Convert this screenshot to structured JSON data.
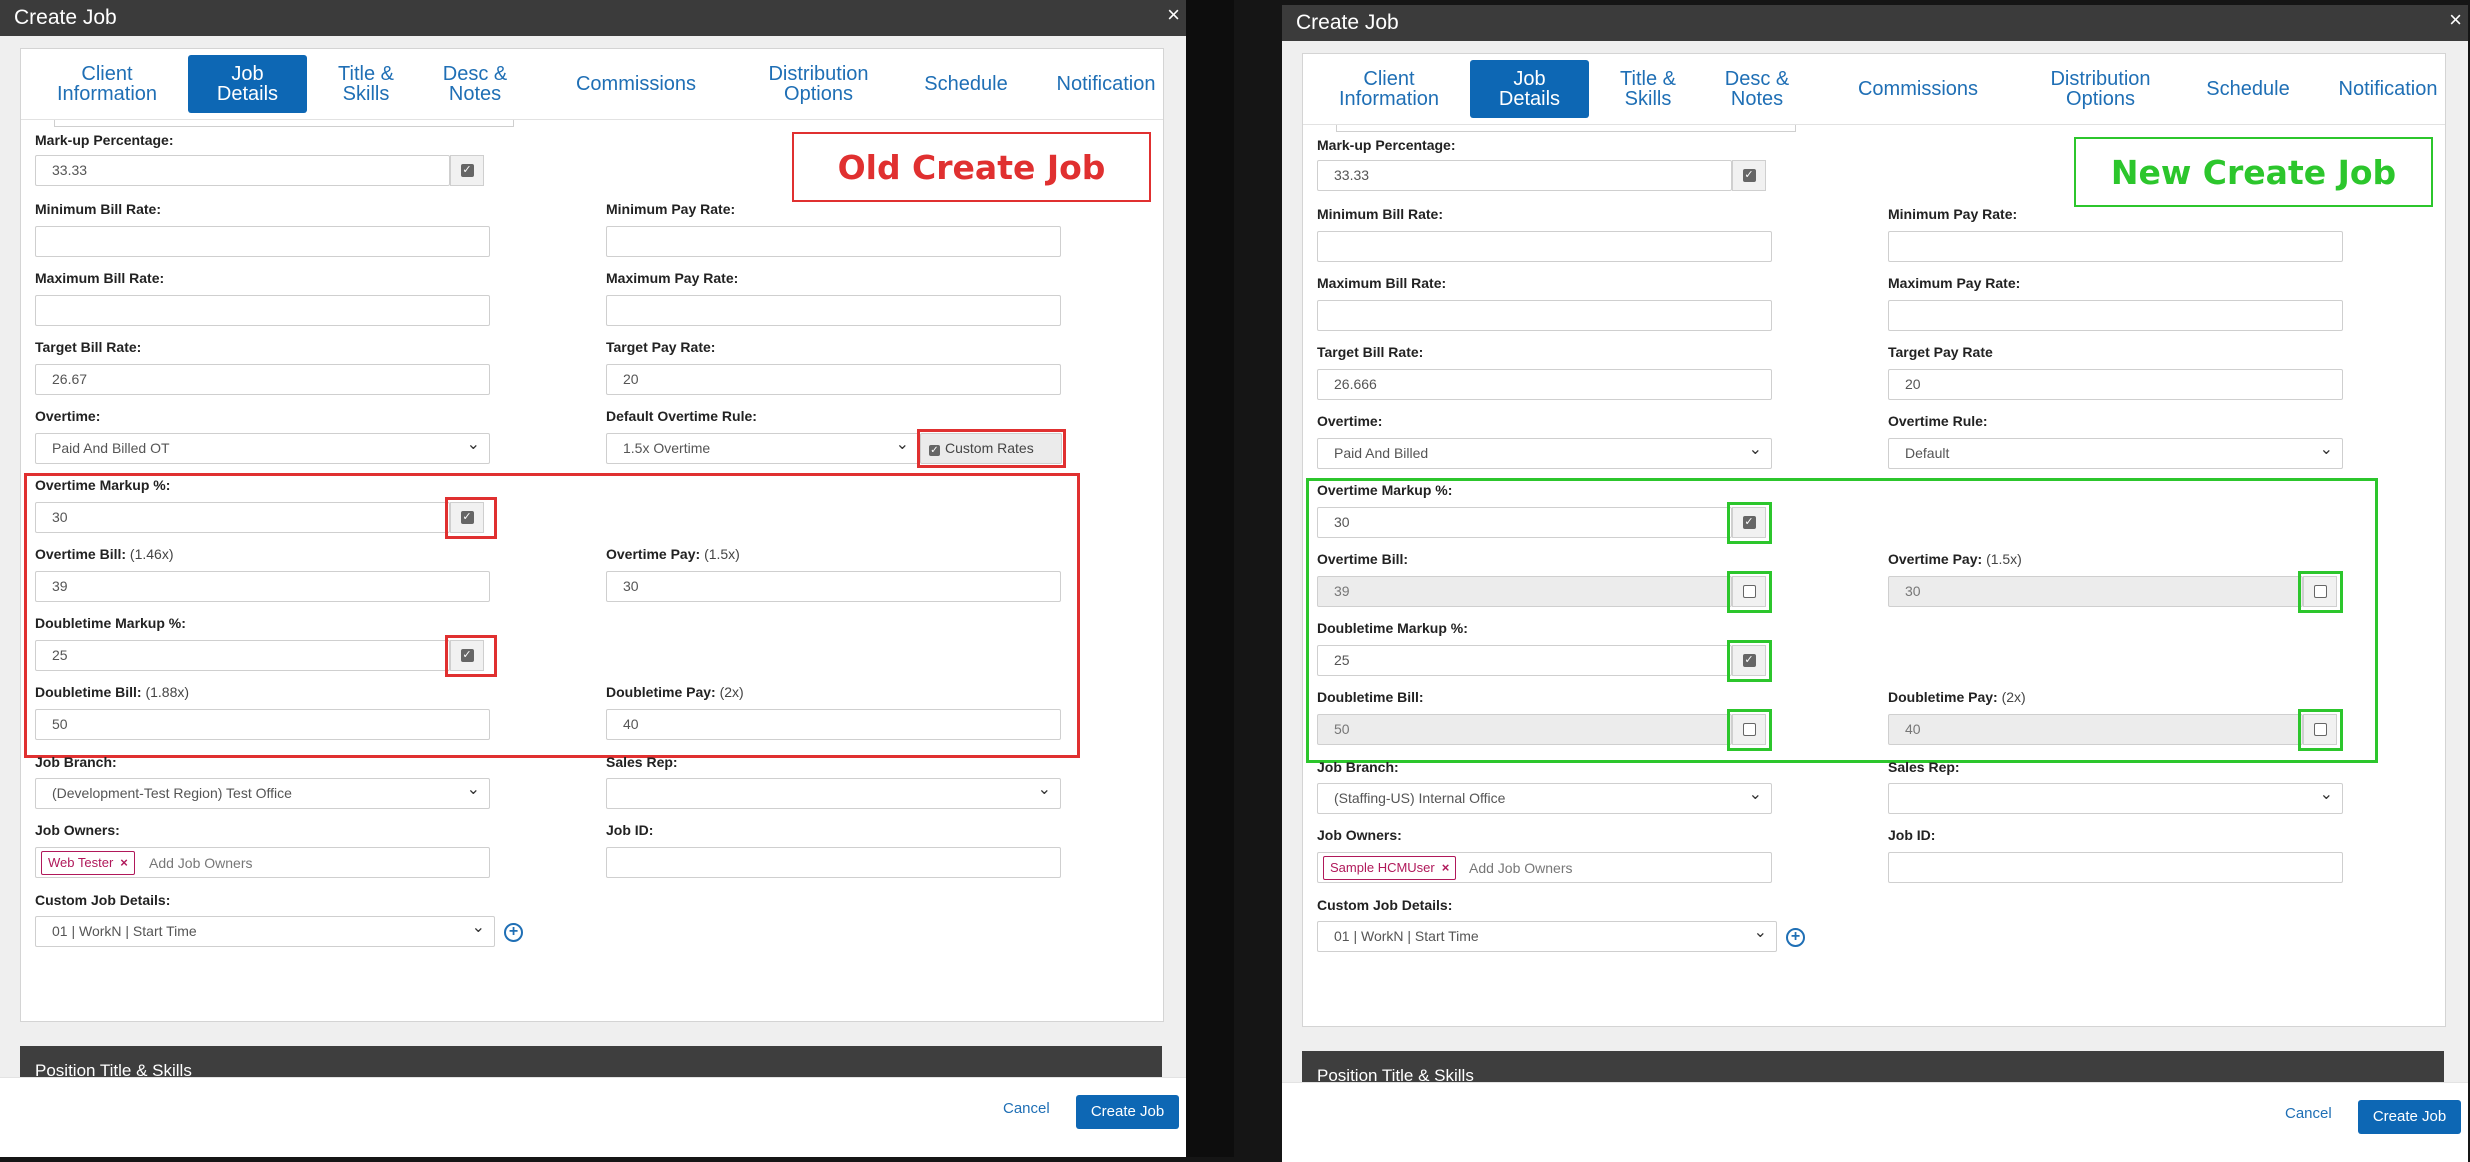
{
  "old": {
    "title": "Create Job",
    "close": "×",
    "annotation": "Old Create Job",
    "tabs": [
      {
        "label": "Client\nInformation"
      },
      {
        "label": "Job\nDetails"
      },
      {
        "label": "Title &\nSkills"
      },
      {
        "label": "Desc &\nNotes"
      },
      {
        "label": "Commissions"
      },
      {
        "label": "Distribution\nOptions"
      },
      {
        "label": "Schedule"
      },
      {
        "label": "Notification"
      }
    ],
    "markup_label": "Mark-up Percentage:",
    "markup_value": "33.33",
    "min_bill_label": "Minimum Bill Rate:",
    "min_pay_label": "Minimum Pay Rate:",
    "max_bill_label": "Maximum Bill Rate:",
    "max_pay_label": "Maximum Pay Rate:",
    "target_bill_label": "Target Bill Rate:",
    "target_bill_value": "26.67",
    "target_pay_label": "Target Pay Rate:",
    "target_pay_value": "20",
    "overtime_label": "Overtime:",
    "overtime_value": "Paid And Billed OT",
    "ot_rule_label": "Default Overtime Rule:",
    "ot_rule_value": "1.5x Overtime",
    "custom_rates_label": "Custom Rates",
    "ot_markup_label": "Overtime Markup %:",
    "ot_markup_value": "30",
    "ot_bill_label": "Overtime Bill:",
    "ot_bill_sub": "(1.46x)",
    "ot_bill_value": "39",
    "ot_pay_label": "Overtime Pay:",
    "ot_pay_sub": "(1.5x)",
    "ot_pay_value": "30",
    "dt_markup_label": "Doubletime Markup %:",
    "dt_markup_value": "25",
    "dt_bill_label": "Doubletime Bill:",
    "dt_bill_sub": "(1.88x)",
    "dt_bill_value": "50",
    "dt_pay_label": "Doubletime Pay:",
    "dt_pay_sub": "(2x)",
    "dt_pay_value": "40",
    "branch_label": "Job Branch:",
    "branch_value": "(Development-Test Region) Test Office",
    "sales_label": "Sales Rep:",
    "owners_label": "Job Owners:",
    "owner_tag": "Web Tester",
    "owners_placeholder": "Add Job Owners",
    "jobid_label": "Job ID:",
    "custom_label": "Custom Job Details:",
    "custom_value": "01 | WorkN | Start Time",
    "section_title": "Position Title & Skills",
    "cancel": "Cancel",
    "create": "Create Job"
  },
  "new": {
    "title": "Create Job",
    "close": "×",
    "annotation": "New Create Job",
    "tabs": [
      {
        "label": "Client\nInformation"
      },
      {
        "label": "Job\nDetails"
      },
      {
        "label": "Title &\nSkills"
      },
      {
        "label": "Desc &\nNotes"
      },
      {
        "label": "Commissions"
      },
      {
        "label": "Distribution\nOptions"
      },
      {
        "label": "Schedule"
      },
      {
        "label": "Notification"
      }
    ],
    "markup_label": "Mark-up Percentage:",
    "markup_value": "33.33",
    "min_bill_label": "Minimum Bill Rate:",
    "min_pay_label": "Minimum Pay Rate:",
    "max_bill_label": "Maximum Bill Rate:",
    "max_pay_label": "Maximum Pay Rate:",
    "target_bill_label": "Target Bill Rate:",
    "target_bill_value": "26.666",
    "target_pay_label": "Target Pay Rate",
    "target_pay_value": "20",
    "overtime_label": "Overtime:",
    "overtime_value": "Paid And Billed",
    "ot_rule_label": "Overtime Rule:",
    "ot_rule_value": "Default",
    "ot_markup_label": "Overtime Markup %:",
    "ot_markup_value": "30",
    "ot_bill_label": "Overtime Bill:",
    "ot_bill_value": "39",
    "ot_pay_label": "Overtime Pay:",
    "ot_pay_sub": "(1.5x)",
    "ot_pay_value": "30",
    "dt_markup_label": "Doubletime Markup %:",
    "dt_markup_value": "25",
    "dt_bill_label": "Doubletime Bill:",
    "dt_bill_value": "50",
    "dt_pay_label": "Doubletime Pay:",
    "dt_pay_sub": "(2x)",
    "dt_pay_value": "40",
    "branch_label": "Job Branch:",
    "branch_value": "(Staffing-US) Internal Office",
    "sales_label": "Sales Rep:",
    "owners_label": "Job Owners:",
    "owner_tag": "Sample HCMUser",
    "owners_placeholder": "Add Job Owners",
    "jobid_label": "Job ID:",
    "custom_label": "Custom Job Details:",
    "custom_value": "01 | WorkN | Start Time",
    "section_title": "Position Title & Skills",
    "cancel": "Cancel",
    "create": "Create Job"
  }
}
